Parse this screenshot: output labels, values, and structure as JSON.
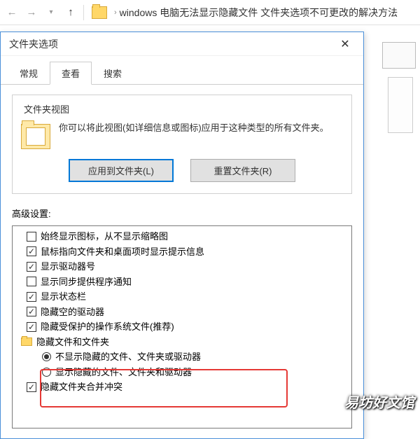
{
  "explorer": {
    "path": "windows 电脑无法显示隐藏文件 文件夹选项不可更改的解决方法"
  },
  "dialog": {
    "title": "文件夹选项",
    "tabs": {
      "general": "常规",
      "view": "查看",
      "search": "搜索"
    }
  },
  "folderView": {
    "groupLabel": "文件夹视图",
    "description": "你可以将此视图(如详细信息或图标)应用于这种类型的所有文件夹。",
    "applyBtn": "应用到文件夹(L)",
    "resetBtn": "重置文件夹(R)"
  },
  "advanced": {
    "label": "高级设置:",
    "items": [
      {
        "type": "checkbox",
        "checked": false,
        "label": "始终显示图标，从不显示缩略图"
      },
      {
        "type": "checkbox",
        "checked": true,
        "label": "鼠标指向文件夹和桌面项时显示提示信息"
      },
      {
        "type": "checkbox",
        "checked": true,
        "label": "显示驱动器号"
      },
      {
        "type": "checkbox",
        "checked": false,
        "label": "显示同步提供程序通知"
      },
      {
        "type": "checkbox",
        "checked": true,
        "label": "显示状态栏"
      },
      {
        "type": "checkbox",
        "checked": true,
        "label": "隐藏空的驱动器"
      },
      {
        "type": "checkbox",
        "checked": true,
        "label": "隐藏受保护的操作系统文件(推荐)"
      },
      {
        "type": "header",
        "label": "隐藏文件和文件夹"
      },
      {
        "type": "radio",
        "checked": true,
        "label": "不显示隐藏的文件、文件夹或驱动器",
        "indent": true
      },
      {
        "type": "radio",
        "checked": false,
        "label": "显示隐藏的文件、文件夹和驱动器",
        "indent": true
      },
      {
        "type": "checkbox",
        "checked": true,
        "label": "隐藏文件夹合并冲突"
      }
    ]
  },
  "watermark": "易坊好文馆"
}
